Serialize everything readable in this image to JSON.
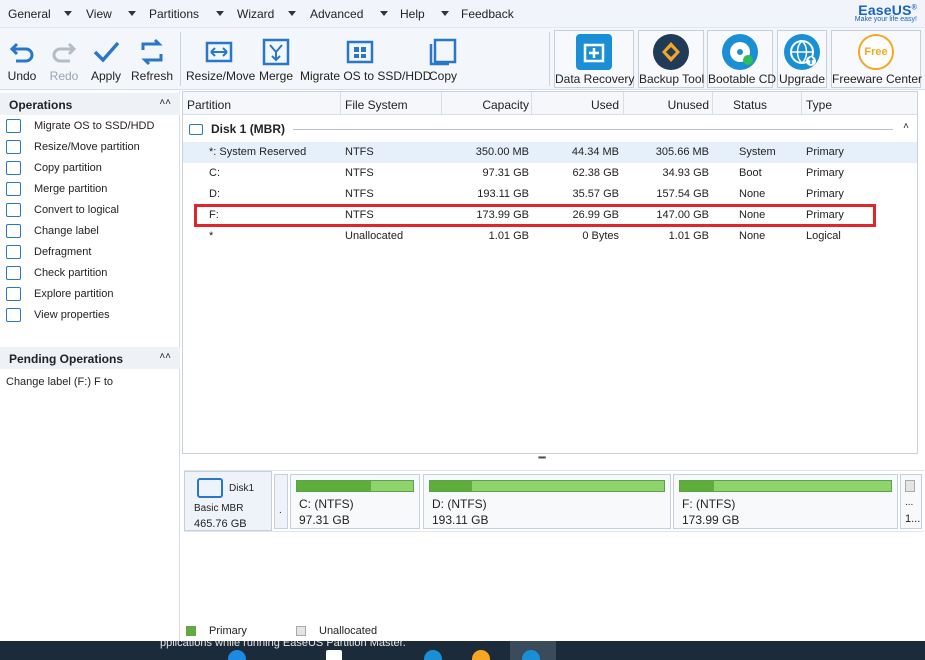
{
  "menu": {
    "items": [
      "General",
      "View",
      "Partitions",
      "Wizard",
      "Advanced",
      "Help",
      "Feedback"
    ],
    "brand": "EaseUS",
    "brand_mark": "®",
    "tagline": "Make your life easy!"
  },
  "toolbar": {
    "undo": "Undo",
    "redo": "Redo",
    "apply": "Apply",
    "refresh": "Refresh",
    "resize_move": "Resize/Move",
    "merge": "Merge",
    "migrate": "Migrate OS to SSD/HDD",
    "copy": "Copy",
    "data_recovery": "Data Recovery",
    "backup_tool": "Backup Tool",
    "bootable_cd": "Bootable CD",
    "upgrade": "Upgrade",
    "freeware_center": "Freeware Center",
    "free_badge": "Free"
  },
  "operations": {
    "title": "Operations",
    "items": [
      {
        "label": "Migrate OS to SSD/HDD",
        "icon": "migrate-icon"
      },
      {
        "label": "Resize/Move partition",
        "icon": "resize-icon"
      },
      {
        "label": "Copy partition",
        "icon": "copy-icon"
      },
      {
        "label": "Merge partition",
        "icon": "merge-icon"
      },
      {
        "label": "Convert to logical",
        "icon": "convert-icon"
      },
      {
        "label": "Change label",
        "icon": "label-icon"
      },
      {
        "label": "Defragment",
        "icon": "defragment-icon"
      },
      {
        "label": "Check partition",
        "icon": "check-icon"
      },
      {
        "label": "Explore partition",
        "icon": "explore-icon"
      },
      {
        "label": "View properties",
        "icon": "properties-icon"
      }
    ]
  },
  "pending": {
    "title": "Pending Operations",
    "items": [
      "Change label (F:) F to"
    ]
  },
  "table": {
    "headers": [
      "Partition",
      "File System",
      "Capacity",
      "Used",
      "Unused",
      "Status",
      "Type"
    ],
    "disk_label": "Disk 1 (MBR)",
    "rows": [
      {
        "partition": "*: System Reserved",
        "fs": "NTFS",
        "capacity": "350.00 MB",
        "used": "44.34 MB",
        "unused": "305.66 MB",
        "status": "System",
        "type": "Primary"
      },
      {
        "partition": "C:",
        "fs": "NTFS",
        "capacity": "97.31 GB",
        "used": "62.38 GB",
        "unused": "34.93 GB",
        "status": "Boot",
        "type": "Primary"
      },
      {
        "partition": "D:",
        "fs": "NTFS",
        "capacity": "193.11 GB",
        "used": "35.57 GB",
        "unused": "157.54 GB",
        "status": "None",
        "type": "Primary"
      },
      {
        "partition": "F:",
        "fs": "NTFS",
        "capacity": "173.99 GB",
        "used": "26.99 GB",
        "unused": "147.00 GB",
        "status": "None",
        "type": "Primary"
      },
      {
        "partition": "*",
        "fs": "Unallocated",
        "capacity": "1.01 GB",
        "used": "0 Bytes",
        "unused": "1.01 GB",
        "status": "None",
        "type": "Logical"
      }
    ]
  },
  "diskmap": {
    "disk_name": "Disk1",
    "disk_type": "Basic MBR",
    "disk_size": "465.76 GB",
    "small_block": ".",
    "tail_block": "1...",
    "tail_dots": "...",
    "blocks": [
      {
        "name": "C: (NTFS)",
        "size": "97.31 GB",
        "used_fraction": 0.64
      },
      {
        "name": "D: (NTFS)",
        "size": "193.11 GB",
        "used_fraction": 0.18
      },
      {
        "name": "F: (NTFS)",
        "size": "173.99 GB",
        "used_fraction": 0.16
      }
    ]
  },
  "legend": {
    "primary": "Primary",
    "unallocated": "Unallocated"
  },
  "taskbar": {
    "tip": "pplications while running EaseUS Partition Master."
  },
  "colors": {
    "accent": "#2a77c8",
    "selected_row": "#e6f0fb",
    "highlight_box": "#e0252b",
    "bar_used": "#5fae3c",
    "bar_free": "#8fd36c"
  }
}
